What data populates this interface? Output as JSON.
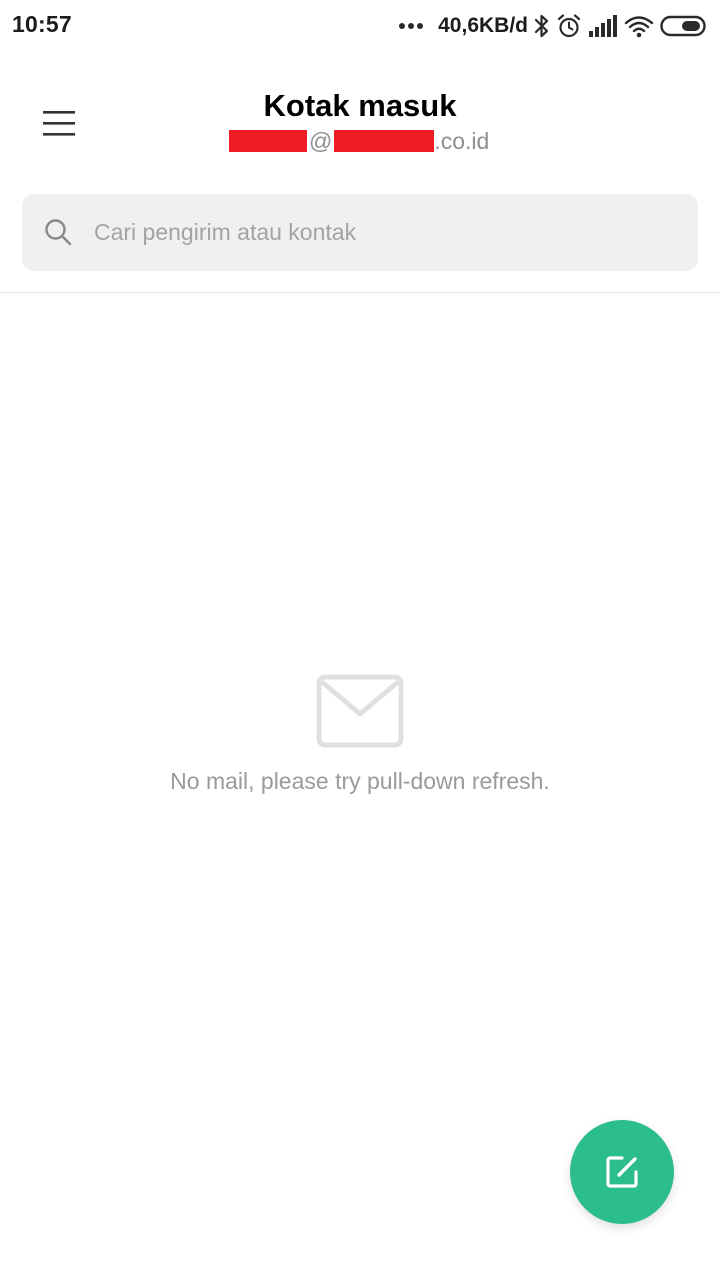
{
  "status_bar": {
    "time": "10:57",
    "network_speed": "40,6KB/d",
    "icons": [
      "more-dots-icon",
      "bluetooth-icon",
      "alarm-icon",
      "signal-icon",
      "wifi-icon",
      "battery-icon"
    ]
  },
  "header": {
    "title": "Kotak masuk",
    "account": {
      "separator": "@",
      "domain_suffix": ".co.id"
    },
    "menu_icon": "hamburger-menu-icon"
  },
  "search": {
    "placeholder": "Cari pengirim atau kontak",
    "value": "",
    "icon": "search-icon"
  },
  "empty_state": {
    "icon": "envelope-icon",
    "message": "No mail, please try pull-down refresh."
  },
  "fab": {
    "icon": "compose-icon"
  },
  "colors": {
    "accent": "#2bbd8c",
    "redaction": "#ee1c25",
    "search_bg": "#f0f0f0",
    "muted_text": "#9a9a9a"
  }
}
